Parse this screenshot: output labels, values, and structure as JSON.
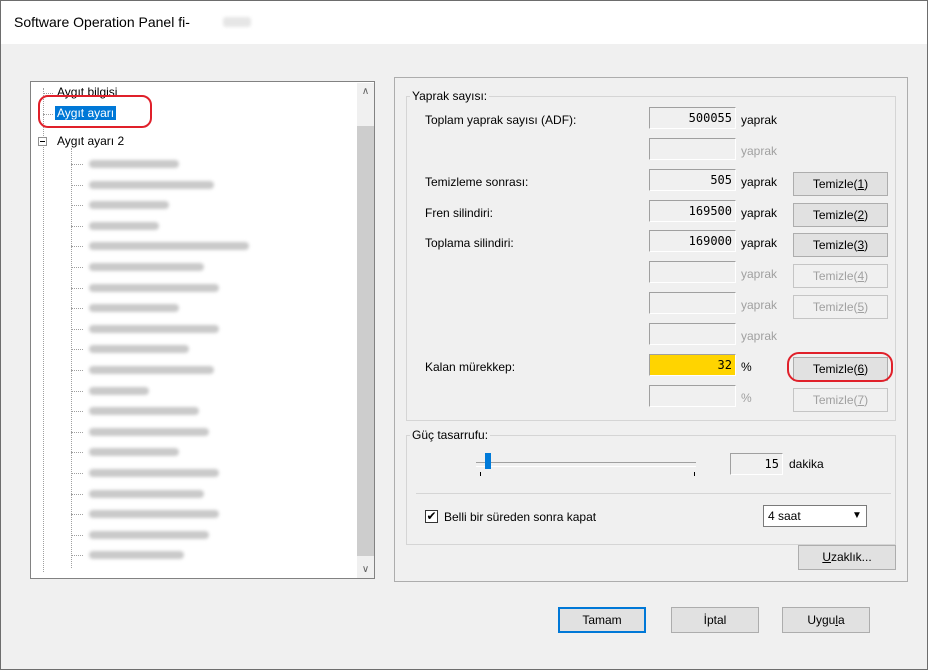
{
  "window": {
    "title": "Software Operation Panel fi-"
  },
  "tree": {
    "items": [
      {
        "label": "Aygıt bilgisi"
      },
      {
        "label": "Aygıt ayarı"
      },
      {
        "label": "Aygıt ayarı 2"
      }
    ]
  },
  "counters": {
    "group_label": "Yaprak sayısı:",
    "rows": [
      {
        "label": "Toplam yaprak sayısı (ADF):",
        "value": "500055",
        "unit": "yaprak",
        "button": "",
        "enabled": true
      },
      {
        "label": "",
        "value": "",
        "unit": "yaprak",
        "button": "",
        "enabled": false
      },
      {
        "label": "Temizleme sonrası:",
        "value": "505",
        "unit": "yaprak",
        "button": "Temizle(1)",
        "enabled": true
      },
      {
        "label": "Fren silindiri:",
        "value": "169500",
        "unit": "yaprak",
        "button": "Temizle(2)",
        "enabled": true
      },
      {
        "label": "Toplama silindiri:",
        "value": "169000",
        "unit": "yaprak",
        "button": "Temizle(3)",
        "enabled": true
      },
      {
        "label": "",
        "value": "",
        "unit": "yaprak",
        "button": "Temizle(4)",
        "enabled": false
      },
      {
        "label": "",
        "value": "",
        "unit": "yaprak",
        "button": "Temizle(5)",
        "enabled": false
      },
      {
        "label": "",
        "value": "",
        "unit": "yaprak",
        "button": "",
        "enabled": false
      },
      {
        "label": "Kalan mürekkep:",
        "value": "32",
        "unit": "%",
        "button": "Temizle(6)",
        "enabled": true
      },
      {
        "label": "",
        "value": "",
        "unit": "%",
        "button": "Temizle(7)",
        "enabled": false
      }
    ]
  },
  "power": {
    "group_label": "Güç tasarrufu:",
    "value": "15",
    "unit": "dakika",
    "slider_fraction": 0.05,
    "checkbox_label": "Belli bir süreden sonra kapat",
    "checkbox_checked": true,
    "checkbox_mark": "✔",
    "combo_value": "4 saat",
    "remote_button": "Uzaklık..."
  },
  "dialog": {
    "ok": "Tamam",
    "cancel": "İptal",
    "apply": "Uygula"
  },
  "colors": {
    "selection": "#0078d7",
    "highlight_field": "#ffd400",
    "annotation": "#e0202a"
  }
}
